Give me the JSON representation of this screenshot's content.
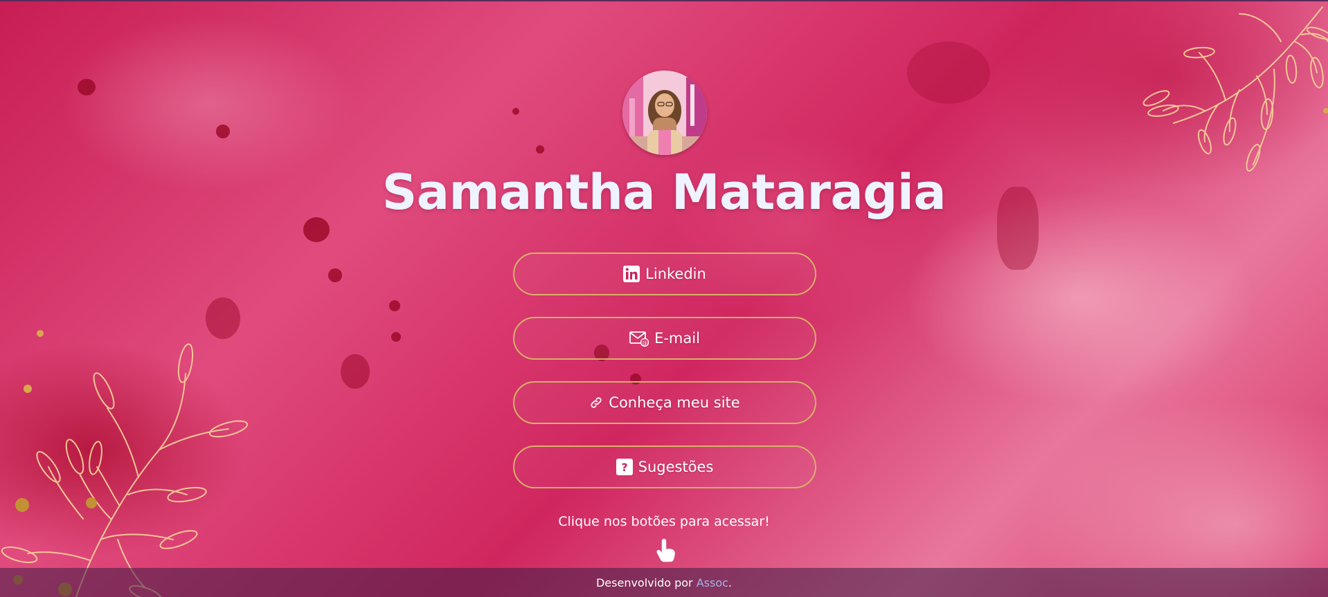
{
  "profile": {
    "name": "Samantha Mataragia"
  },
  "links": [
    {
      "label": "Linkedin",
      "icon": "linkedin-icon"
    },
    {
      "label": "E-mail",
      "icon": "email-icon"
    },
    {
      "label": "Conheça meu site",
      "icon": "link-icon"
    },
    {
      "label": "Sugestões",
      "icon": "question-icon"
    }
  ],
  "hint": {
    "text": "Clique nos botões para acessar!",
    "icon": "pointing-hand-icon"
  },
  "footer": {
    "prefix": "Desenvolvido por ",
    "link_text": "Assoc",
    "suffix": "."
  },
  "colors": {
    "background": "#d0265f",
    "button_border": "#d8b267",
    "title": "#eef3ff",
    "footer_link": "#9fb6e8",
    "branch_gold": "#f3c895"
  }
}
